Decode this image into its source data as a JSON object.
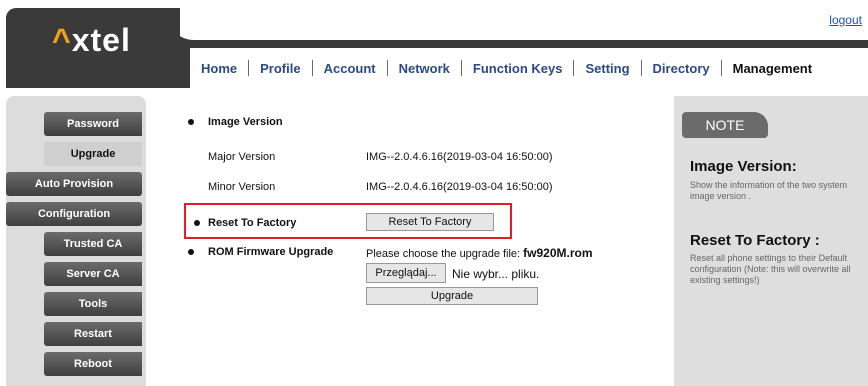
{
  "header": {
    "logo_text": "xtel",
    "logo_mark": "^",
    "logout": "logout",
    "nav": [
      {
        "label": "Home"
      },
      {
        "label": "Profile"
      },
      {
        "label": "Account"
      },
      {
        "label": "Network"
      },
      {
        "label": "Function Keys"
      },
      {
        "label": "Setting"
      },
      {
        "label": "Directory"
      },
      {
        "label": "Management",
        "active": true
      }
    ]
  },
  "sidebar": {
    "items": [
      {
        "label": "Password"
      },
      {
        "label": "Upgrade",
        "active": true
      },
      {
        "label": "Auto Provision"
      },
      {
        "label": "Configuration"
      },
      {
        "label": "Trusted CA"
      },
      {
        "label": "Server CA"
      },
      {
        "label": "Tools"
      },
      {
        "label": "Restart"
      },
      {
        "label": "Reboot"
      }
    ]
  },
  "main": {
    "image_version_title": "Image Version",
    "major_version_label": "Major Version",
    "major_version_value": "IMG--2.0.4.6.16(2019-03-04 16:50:00)",
    "minor_version_label": "Minor Version",
    "minor_version_value": "IMG--2.0.4.6.16(2019-03-04 16:50:00)",
    "reset_label": "Reset To Factory",
    "reset_button": "Reset To Factory",
    "rom_label": "ROM Firmware Upgrade",
    "rom_instruction": "Please choose the upgrade file:",
    "rom_file": "fw920M.rom",
    "browse_button": "Przeglądaj...",
    "file_status": "Nie wybr... pliku.",
    "upgrade_button": "Upgrade"
  },
  "note": {
    "title": "NOTE",
    "image_heading": "Image Version:",
    "image_text": "Show the information of the two system image version .",
    "reset_heading": "Reset To Factory :",
    "reset_text": "Reset all phone settings to their Default configuration (Note: this will overwrite all existing settings!)"
  },
  "colors": {
    "header_bg": "#3a3a3a",
    "accent_orange": "#f2a21b",
    "nav_text": "#2b4a85",
    "highlight_red": "#e21d26"
  }
}
